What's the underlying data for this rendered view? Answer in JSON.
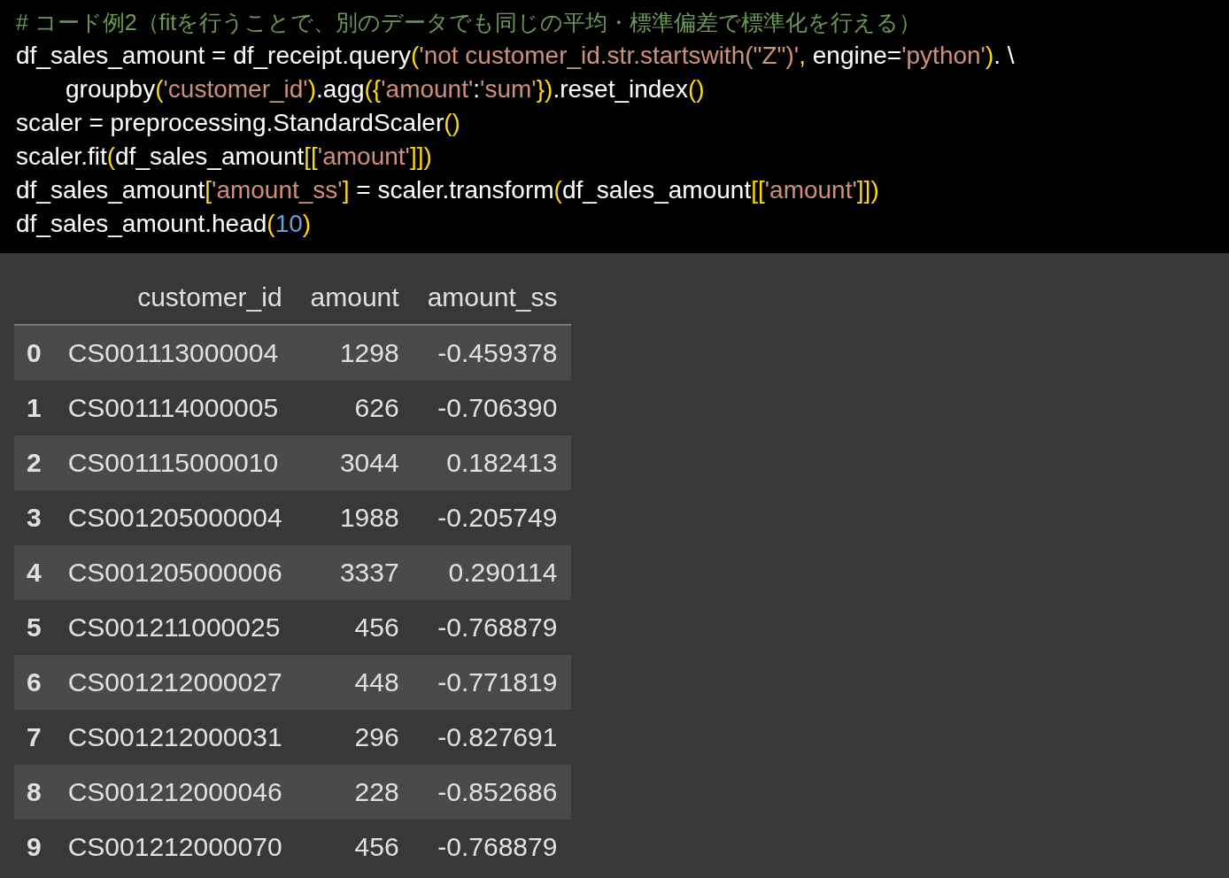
{
  "code_cell": {
    "lines": [
      {
        "indent": false,
        "tokens": [
          {
            "kind": "comment",
            "text": "# コード例2（fitを行うことで、別のデータでも同じの平均・標準偏差で標準化を行える）"
          }
        ]
      },
      {
        "indent": false,
        "tokens": [
          {
            "kind": "plain",
            "text": "df_sales_amount = df_receipt.query"
          },
          {
            "kind": "bracket",
            "text": "("
          },
          {
            "kind": "string",
            "text": "'not customer_id.str.startswith(\"Z\")'"
          },
          {
            "kind": "bracket",
            "text": ","
          },
          {
            "kind": "plain",
            "text": " engine="
          },
          {
            "kind": "string",
            "text": "'python'"
          },
          {
            "kind": "bracket",
            "text": ")"
          },
          {
            "kind": "plain",
            "text": ". \\"
          }
        ]
      },
      {
        "indent": true,
        "tokens": [
          {
            "kind": "plain",
            "text": "groupby"
          },
          {
            "kind": "bracket",
            "text": "("
          },
          {
            "kind": "string",
            "text": "'customer_id'"
          },
          {
            "kind": "bracket",
            "text": ")"
          },
          {
            "kind": "plain",
            "text": ".agg"
          },
          {
            "kind": "bracket",
            "text": "({"
          },
          {
            "kind": "string",
            "text": "'amount'"
          },
          {
            "kind": "plain",
            "text": ":"
          },
          {
            "kind": "string",
            "text": "'sum'"
          },
          {
            "kind": "bracket",
            "text": "})"
          },
          {
            "kind": "plain",
            "text": ".reset_index"
          },
          {
            "kind": "bracket",
            "text": "()"
          }
        ]
      },
      {
        "indent": false,
        "tokens": [
          {
            "kind": "plain",
            "text": "scaler = preprocessing.StandardScaler"
          },
          {
            "kind": "bracket",
            "text": "()"
          }
        ]
      },
      {
        "indent": false,
        "tokens": [
          {
            "kind": "plain",
            "text": "scaler.fit"
          },
          {
            "kind": "bracket",
            "text": "("
          },
          {
            "kind": "plain",
            "text": "df_sales_amount"
          },
          {
            "kind": "bracket",
            "text": "[["
          },
          {
            "kind": "string",
            "text": "'amount'"
          },
          {
            "kind": "bracket",
            "text": "]])"
          }
        ]
      },
      {
        "indent": false,
        "tokens": [
          {
            "kind": "plain",
            "text": "df_sales_amount"
          },
          {
            "kind": "bracket",
            "text": "["
          },
          {
            "kind": "string",
            "text": "'amount_ss'"
          },
          {
            "kind": "bracket",
            "text": "]"
          },
          {
            "kind": "plain",
            "text": " = scaler.transform"
          },
          {
            "kind": "bracket",
            "text": "("
          },
          {
            "kind": "plain",
            "text": "df_sales_amount"
          },
          {
            "kind": "bracket",
            "text": "[["
          },
          {
            "kind": "string",
            "text": "'amount'"
          },
          {
            "kind": "bracket",
            "text": "]])"
          }
        ]
      },
      {
        "indent": false,
        "tokens": [
          {
            "kind": "plain",
            "text": "df_sales_amount.head"
          },
          {
            "kind": "bracket",
            "text": "("
          },
          {
            "kind": "number",
            "text": "10"
          },
          {
            "kind": "bracket",
            "text": ")"
          }
        ]
      }
    ]
  },
  "output_table": {
    "columns": [
      "customer_id",
      "amount",
      "amount_ss"
    ],
    "rows": [
      {
        "index": "0",
        "cells": [
          "CS001113000004",
          "1298",
          "-0.459378"
        ]
      },
      {
        "index": "1",
        "cells": [
          "CS001114000005",
          "626",
          "-0.706390"
        ]
      },
      {
        "index": "2",
        "cells": [
          "CS001115000010",
          "3044",
          "0.182413"
        ]
      },
      {
        "index": "3",
        "cells": [
          "CS001205000004",
          "1988",
          "-0.205749"
        ]
      },
      {
        "index": "4",
        "cells": [
          "CS001205000006",
          "3337",
          "0.290114"
        ]
      },
      {
        "index": "5",
        "cells": [
          "CS001211000025",
          "456",
          "-0.768879"
        ]
      },
      {
        "index": "6",
        "cells": [
          "CS001212000027",
          "448",
          "-0.771819"
        ]
      },
      {
        "index": "7",
        "cells": [
          "CS001212000031",
          "296",
          "-0.827691"
        ]
      },
      {
        "index": "8",
        "cells": [
          "CS001212000046",
          "228",
          "-0.852686"
        ]
      },
      {
        "index": "9",
        "cells": [
          "CS001212000070",
          "456",
          "-0.768879"
        ]
      }
    ]
  }
}
